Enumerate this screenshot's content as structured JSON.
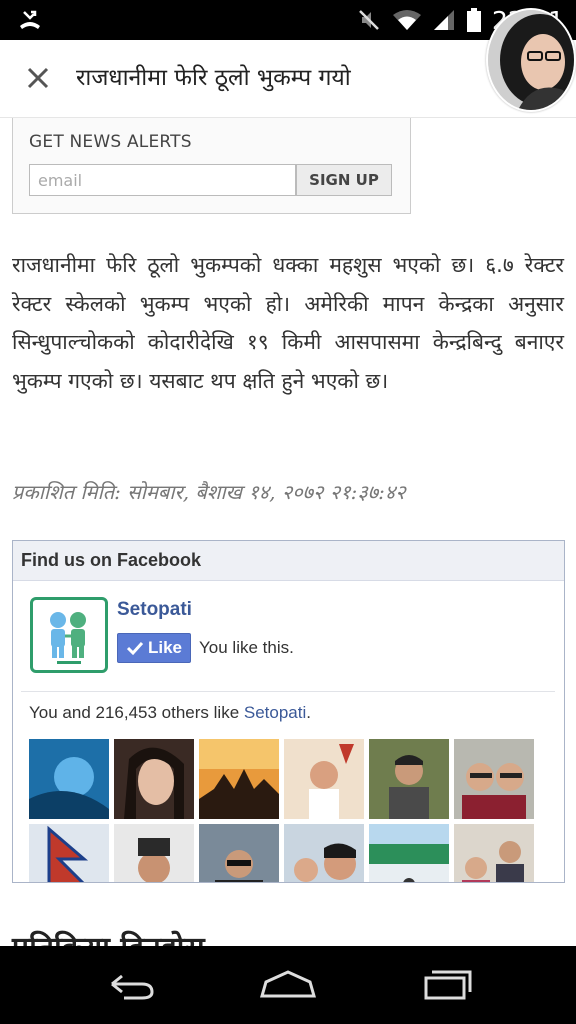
{
  "status_bar": {
    "time": "22:01",
    "icons": [
      "missed-call-icon",
      "mute-icon",
      "wifi-icon",
      "signal-icon",
      "battery-icon"
    ]
  },
  "header": {
    "title": "राजधानीमा फेरि ठूलो भुकम्प गयो",
    "close_icon": "close-icon"
  },
  "news_alerts": {
    "title": "GET NEWS ALERTS",
    "email_placeholder": "email",
    "signup_label": "SIGN UP"
  },
  "article": {
    "body": "राजधानीमा फेरि ठूलो भुकम्पको धक्का महशुस भएको छ। ६.७ रेक्टर रेक्टर स्केलको भुकम्प भएको हो। अमेरिकी मापन केन्द्रका अनुसार सिन्धुपाल्चोकको कोदारीदेखि १९ किमी आसपासमा केन्द्रबिन्दु बनाएर भुकम्प गएको छ। यसबाट थप क्षति हुने भएको छ।",
    "published": "प्रकाशित मिति: सोमबार, बैशाख १४, २०७२ २१:३७:४२"
  },
  "facebook": {
    "header": "Find us on Facebook",
    "page_name": "Setopati",
    "like_label": "Like",
    "you_like": "You like this.",
    "count_prefix": "You and 216,453 others like ",
    "count_link": "Setopati",
    "count_suffix": "."
  },
  "next_section_heading": "प्रतिक्रिया दिनुहोस",
  "colors": {
    "facebook_blue": "#3b5998",
    "like_button": "#5b7bd5",
    "setopati_green": "#2f9d6b"
  }
}
